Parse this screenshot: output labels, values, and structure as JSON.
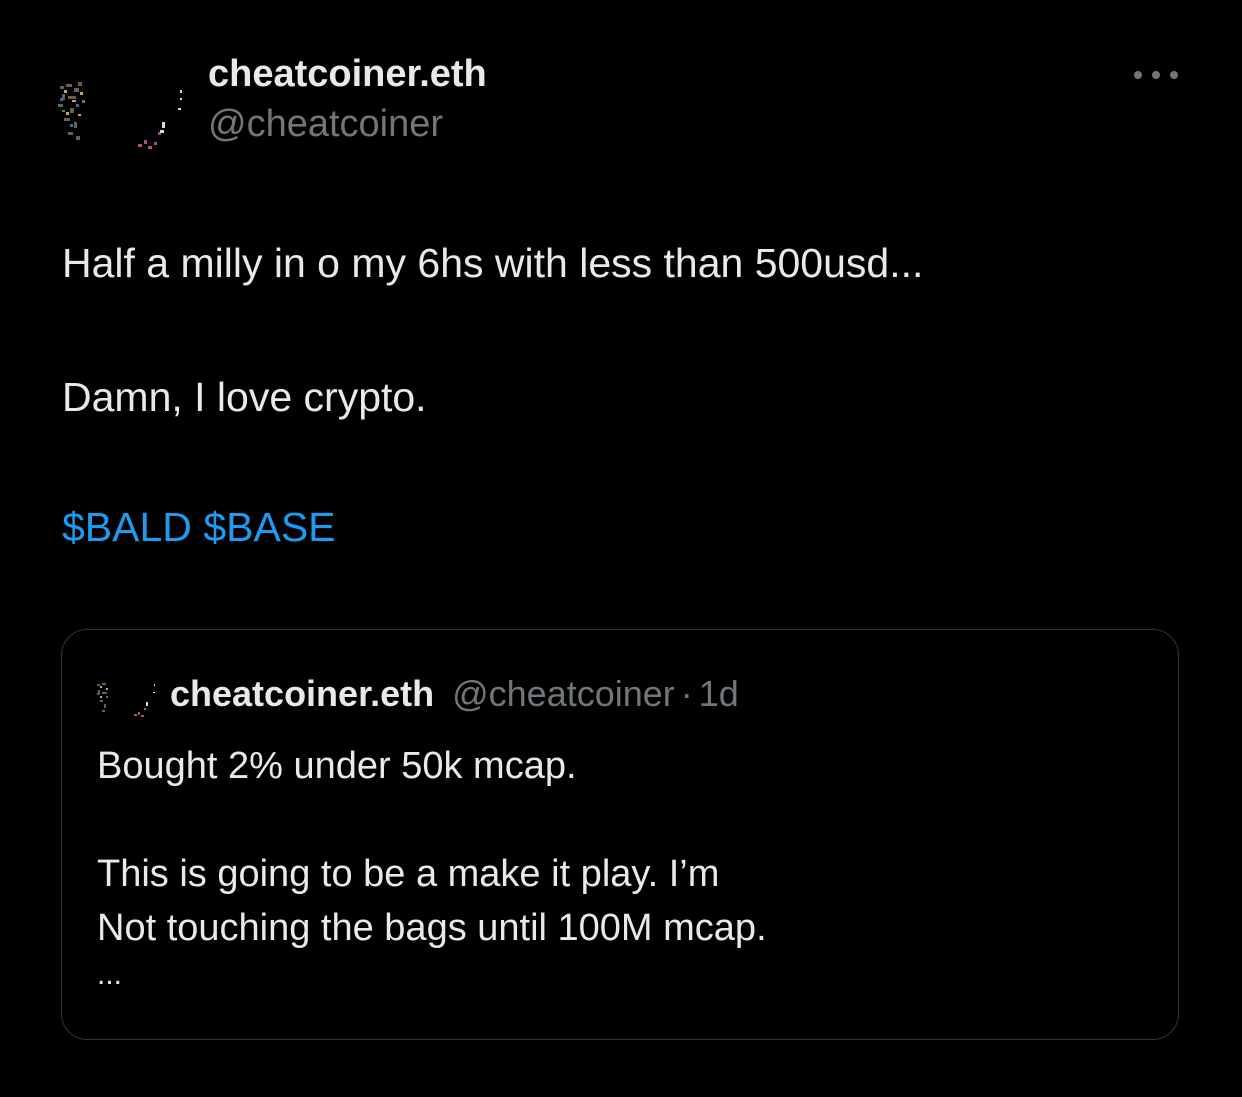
{
  "author": {
    "display_name": "cheatcoiner.eth",
    "handle": "@cheatcoiner"
  },
  "tweet": {
    "lines": [
      "Half a milly in o my 6hs with less than 500usd...",
      "Damn, I love crypto."
    ],
    "cashtags": [
      "$BALD",
      "$BASE"
    ]
  },
  "quoted_tweet": {
    "display_name": "cheatcoiner.eth",
    "handle": "@cheatcoiner",
    "separator": "·",
    "time": "1d",
    "lines": [
      "Bought 2% under 50k mcap.",
      "This is going to be a make it play. I’m",
      "Not touching the bags until 100M mcap.",
      "..."
    ]
  },
  "colors": {
    "background": "#000000",
    "text_primary": "#e7e9ea",
    "text_secondary": "#71767b",
    "link": "#1d9bf0",
    "border": "#2f3336"
  },
  "icons": {
    "more": "more-horizontal-icon",
    "avatar": "user-avatar"
  }
}
